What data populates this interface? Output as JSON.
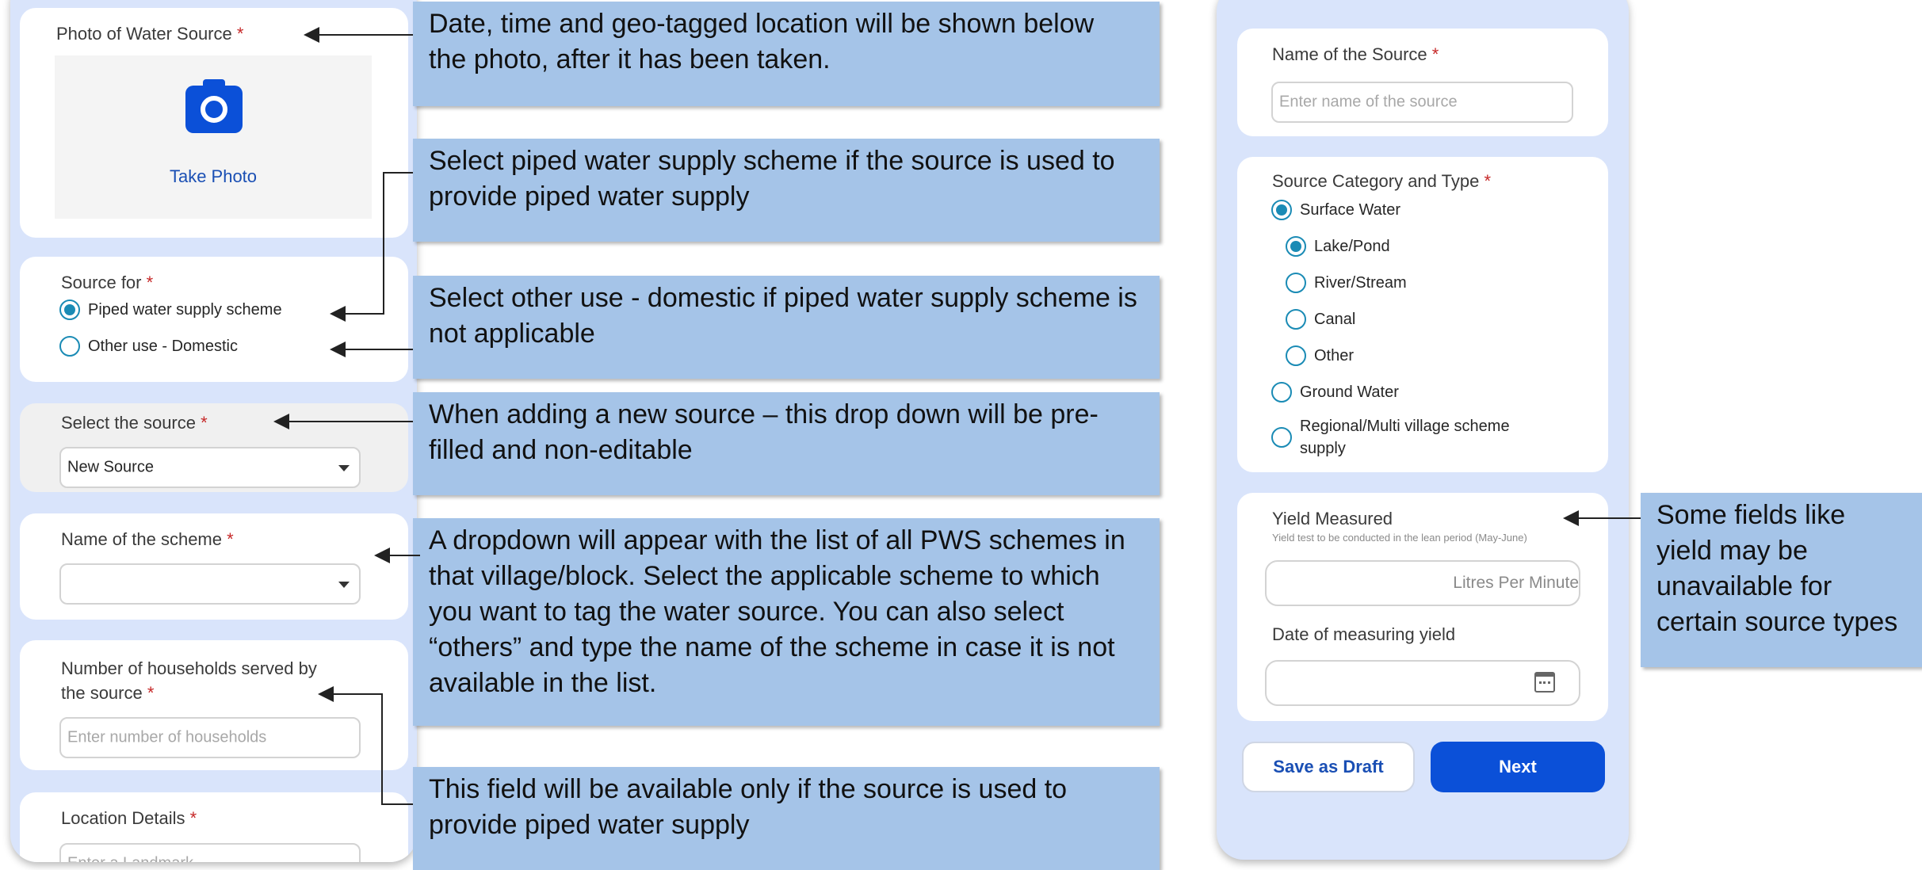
{
  "left_form": {
    "photo": {
      "label": "Photo of Water Source",
      "required": "*",
      "take_photo": "Take Photo"
    },
    "source_for": {
      "label": "Source for",
      "required": "*",
      "options": [
        "Piped water supply scheme",
        "Other use - Domestic"
      ],
      "selected": 0
    },
    "select_source": {
      "label": "Select the source",
      "required": "*",
      "value": "New Source"
    },
    "scheme": {
      "label": "Name of the scheme",
      "required": "*"
    },
    "households": {
      "label_line1": "Number of households served by",
      "label_line2": "the source",
      "required": "*",
      "placeholder": "Enter number of households"
    },
    "location": {
      "label": "Location Details",
      "required": "*",
      "placeholder": "Enter a Landmark"
    }
  },
  "right_form": {
    "source_name": {
      "label": "Name of the Source",
      "required": "*",
      "placeholder": "Enter name of the source"
    },
    "category": {
      "label": "Source Category and Type",
      "required": "*",
      "options": [
        "Surface Water",
        "Lake/Pond",
        "River/Stream",
        "Canal",
        "Other",
        "Ground Water",
        "Regional/Multi village scheme",
        "supply"
      ],
      "selected_category": "Surface Water",
      "selected_type": "Lake/Pond"
    },
    "yield": {
      "label": "Yield Measured",
      "hint": "Yield test to be conducted in the lean period (May-June)",
      "unit": "Litres Per Minute"
    },
    "yield_date": {
      "label": "Date of measuring yield"
    },
    "buttons": {
      "draft": "Save as Draft",
      "next": "Next"
    }
  },
  "callouts": [
    {
      "line1": "Date, time and geo-tagged location will be shown below",
      "line2": "the photo, after it has been taken."
    },
    {
      "line1": "Select piped water supply scheme if the source is used to",
      "line2": "provide piped water supply"
    },
    {
      "line1": "Select other use - domestic if piped water supply scheme is",
      "line2": "not applicable"
    },
    {
      "line1": "When adding a new source – this drop down will be pre-",
      "line2": "filled and non-editable"
    },
    {
      "lines": [
        "A dropdown will appear with the list of all PWS schemes in",
        "that village/block. Select the applicable scheme to which",
        "you want to tag the water source. You can also select",
        "“others” and type the name of the scheme in case it is not",
        "available in the list."
      ]
    },
    {
      "line1": "This field will be available only if the source is used to",
      "line2": "provide piped water supply"
    },
    {
      "lines": [
        "Some fields like",
        "yield may be",
        "unavailable for",
        "certain source types"
      ]
    }
  ],
  "colors": {
    "accent": "#0b50d8",
    "radio": "#1a8bb5",
    "required": "#c62828",
    "callout": "#a5c4e8",
    "phone_bg": "#d9e4fb"
  }
}
